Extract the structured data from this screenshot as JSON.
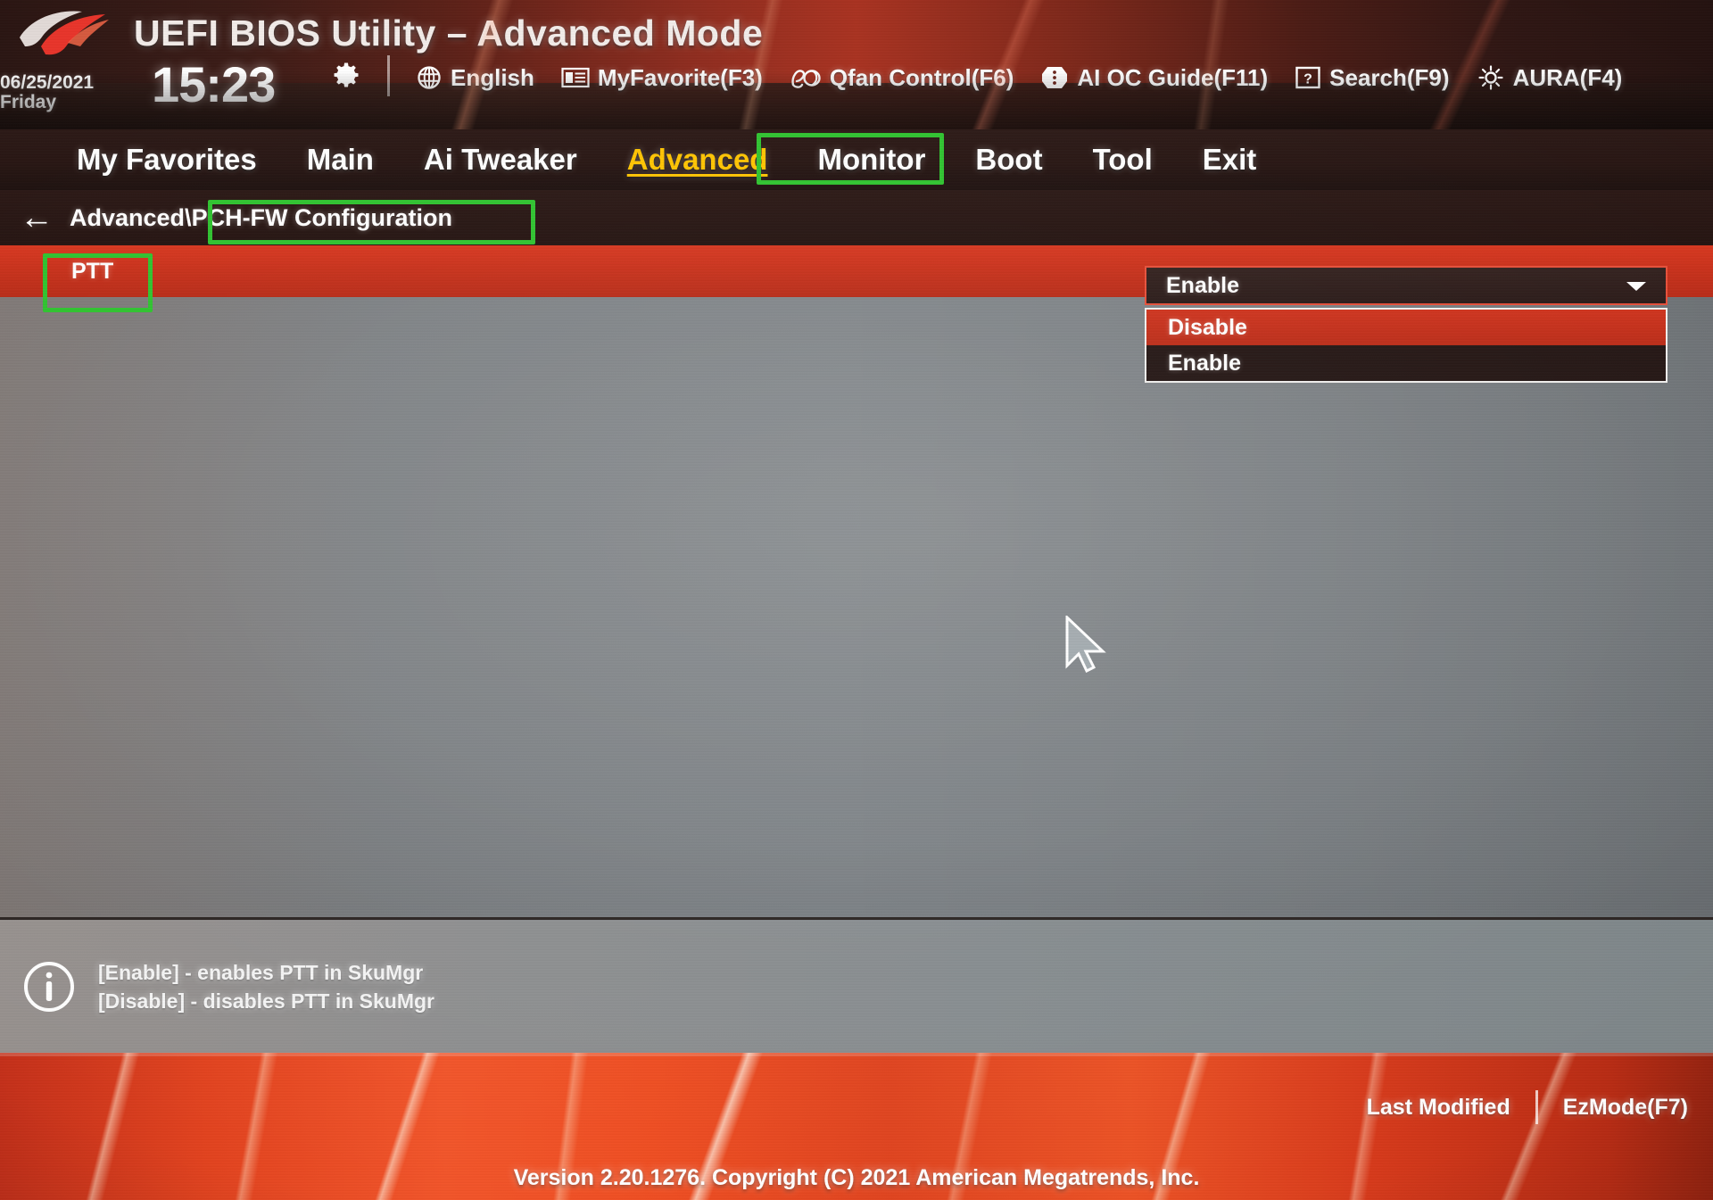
{
  "header": {
    "title": "UEFI BIOS Utility – Advanced Mode",
    "logo": "rog-logo",
    "date": "06/25/2021",
    "weekday": "Friday",
    "time": "15:23",
    "gear_icon": "gear-icon",
    "toolbar": [
      {
        "icon": "globe-icon",
        "label": "English"
      },
      {
        "icon": "myfavorite-icon",
        "label": "MyFavorite(F3)"
      },
      {
        "icon": "qfan-icon",
        "label": "Qfan Control(F6)"
      },
      {
        "icon": "aioc-icon",
        "label": "AI OC Guide(F11)"
      },
      {
        "icon": "search-icon",
        "label": "Search(F9)"
      },
      {
        "icon": "aura-icon",
        "label": "AURA(F4)"
      }
    ]
  },
  "nav": {
    "tabs": [
      {
        "label": "My Favorites",
        "active": false
      },
      {
        "label": "Main",
        "active": false
      },
      {
        "label": "Ai Tweaker",
        "active": false
      },
      {
        "label": "Advanced",
        "active": true
      },
      {
        "label": "Monitor",
        "active": false
      },
      {
        "label": "Boot",
        "active": false
      },
      {
        "label": "Tool",
        "active": false
      },
      {
        "label": "Exit",
        "active": false
      }
    ]
  },
  "breadcrumb": {
    "back_icon": "back-arrow-icon",
    "parent": "Advanced",
    "separator": "\\",
    "current": "PCH-FW Configuration"
  },
  "main": {
    "setting_label": "PTT",
    "select_value": "Enable",
    "chevron_icon": "chevron-down-icon",
    "dropdown_options": [
      {
        "label": "Disable",
        "selected": true
      },
      {
        "label": "Enable",
        "selected": false
      }
    ],
    "cursor_icon": "mouse-cursor"
  },
  "help": {
    "icon": "info-icon",
    "line1": "[Enable] - enables PTT in SkuMgr",
    "line2": "[Disable] - disables PTT in SkuMgr"
  },
  "footer": {
    "last_modified": "Last Modified",
    "ez_mode": "EzMode(F7)",
    "version": "Version 2.20.1276. Copyright (C) 2021 American Megatrends, Inc."
  },
  "annotations": {
    "highlight_color": "#2fc32f",
    "boxes": [
      "advanced-tab",
      "pch-fw-breadcrumb",
      "ptt-label"
    ]
  },
  "colors": {
    "accent_red": "#c7301a",
    "header_red": "#a8301e",
    "active_tab_yellow": "#ffc400",
    "body_gray": "#7f8488",
    "highlight_green": "#2fc32f"
  }
}
